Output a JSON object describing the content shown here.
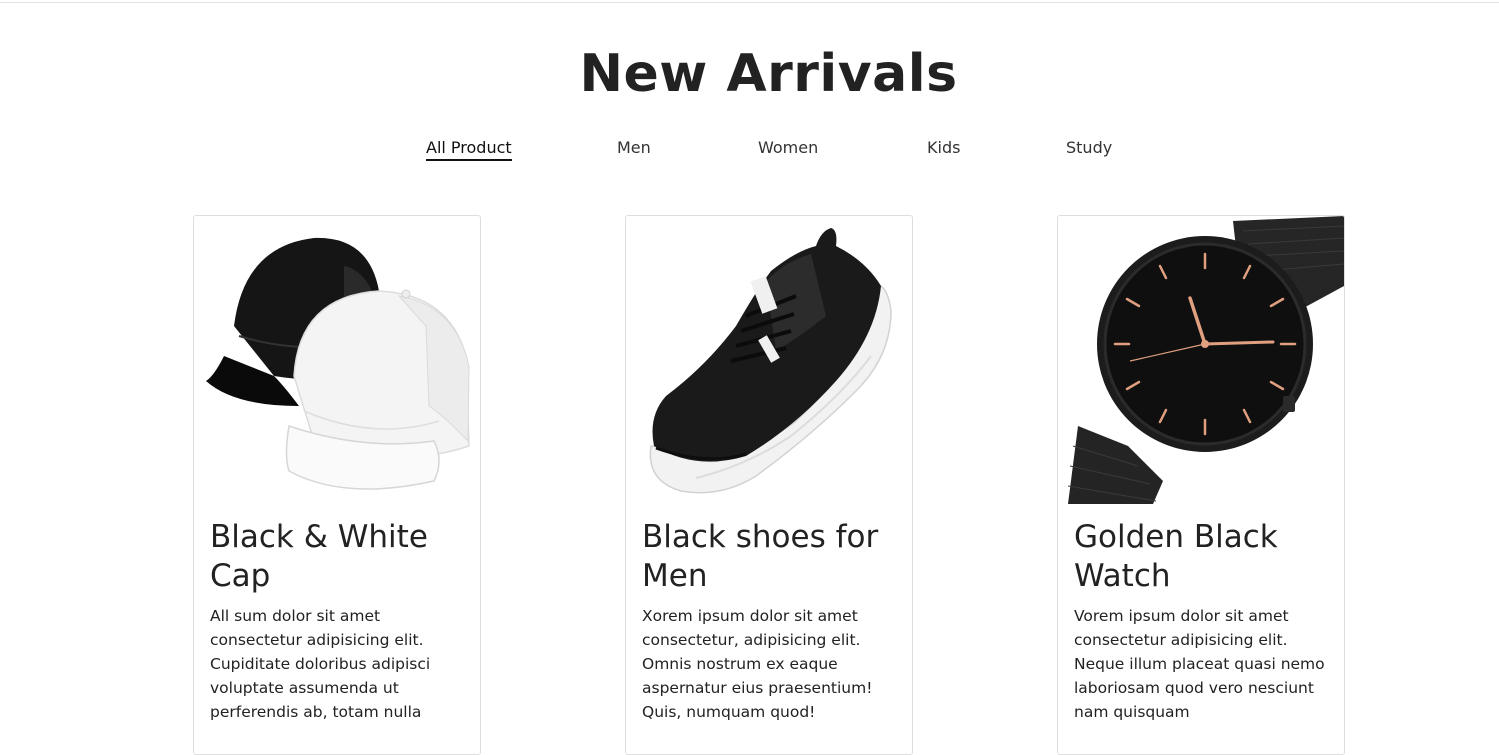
{
  "section": {
    "title": "New Arrivals"
  },
  "filters": [
    {
      "label": "All Product",
      "active": true
    },
    {
      "label": "Men",
      "active": false
    },
    {
      "label": "Women",
      "active": false
    },
    {
      "label": "Kids",
      "active": false
    },
    {
      "label": "Study",
      "active": false
    }
  ],
  "products": [
    {
      "title": "Black & White Cap",
      "description": "All sum dolor sit amet consectetur adipisicing elit. Cupiditate doloribus adipisci voluptate assumenda ut perferendis ab, totam nulla",
      "image": "cap-icon"
    },
    {
      "title": "Black shoes for Men",
      "description": "Xorem ipsum dolor sit amet consectetur, adipisicing elit. Omnis nostrum ex eaque aspernatur eius praesentium! Quis, numquam quod!",
      "image": "shoe-icon"
    },
    {
      "title": "Golden Black Watch",
      "description": "Vorem ipsum dolor sit amet consectetur adipisicing elit. Neque illum placeat quasi nemo laboriosam quod vero nesciunt nam quisquam",
      "image": "watch-icon"
    }
  ],
  "colors": {
    "text": "#222222",
    "border": "#dedede",
    "watch_accent": "#e0a080"
  }
}
